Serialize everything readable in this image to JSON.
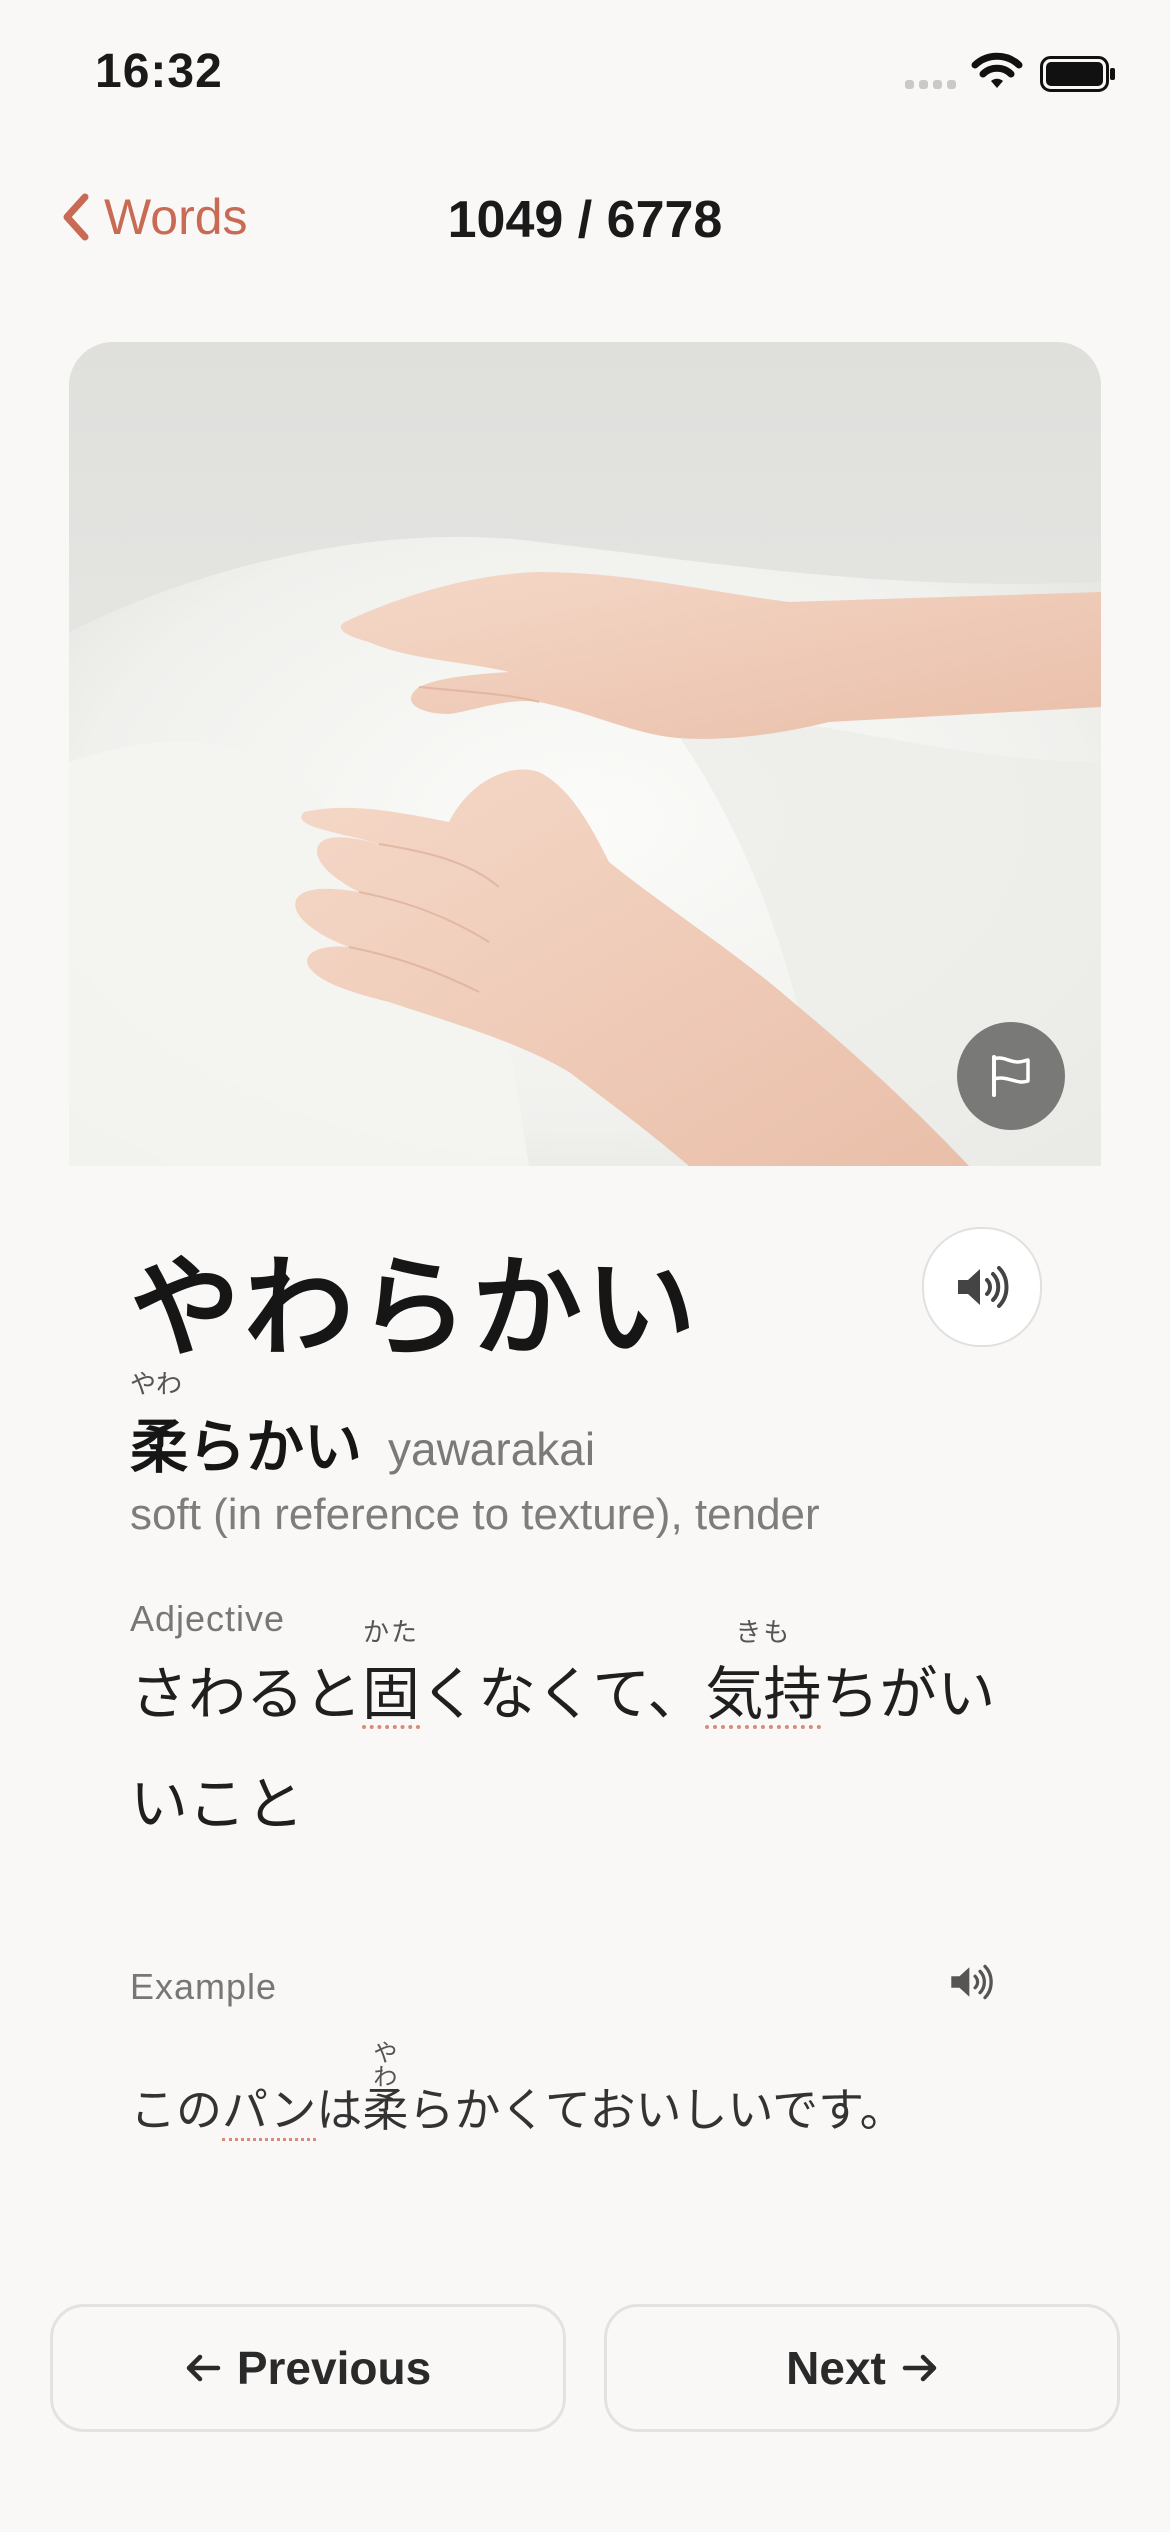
{
  "status_bar": {
    "time": "16:32"
  },
  "nav": {
    "back_label": "Words",
    "counter": "1049 / 6778"
  },
  "word": {
    "kana": "やわらかい",
    "kanji_furigana": "やわ",
    "kanji": "柔らかい",
    "romaji": "yawarakai",
    "meaning": "soft (in reference to texture), tender"
  },
  "definition": {
    "label": "Adjective",
    "parts": [
      "さわると",
      "固",
      "くなくて、",
      "気持",
      "ちがいい",
      "こと"
    ],
    "ruby": [
      "かた",
      "きも"
    ]
  },
  "example": {
    "label": "Example",
    "parts": [
      "この",
      "パン",
      "は",
      "柔",
      "らかくておいしいです。"
    ],
    "ruby": "やわ"
  },
  "buttons": {
    "previous": "Previous",
    "next": "Next"
  },
  "icons": {
    "back": "chevron-left-icon",
    "flag": "flag-icon",
    "speaker": "speaker-icon",
    "arrow_left": "arrow-left-icon",
    "arrow_right": "arrow-right-icon"
  },
  "colors": {
    "accent": "#c86a54",
    "background": "#faf8f6",
    "underline": "#d98a7a"
  }
}
